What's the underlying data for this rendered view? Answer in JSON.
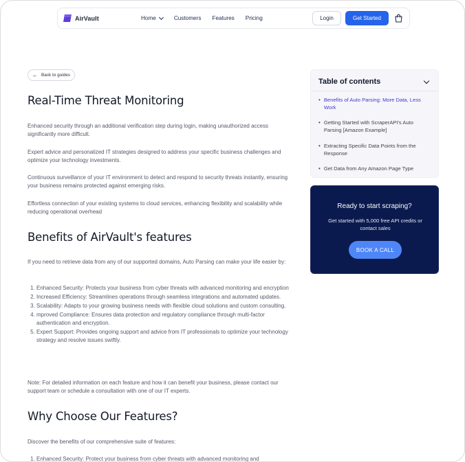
{
  "nav": {
    "brand": "AirVault",
    "menu": [
      "Home",
      "Customers",
      "Features",
      "Pricing"
    ],
    "login": "Login",
    "get_started": "Get Started"
  },
  "main": {
    "back": "Back to guides",
    "title": "Real-Time Threat Monitoring",
    "paragraphs": [
      "Enhanced security through an additional verification step during login, making unauthorized access significantly more difficult.",
      "Expert advice and personalized IT strategies designed to address your specific business challenges and optimize your technology investments.",
      "Continuous surveillance of your IT environment to detect and respond to security threats instantly, ensuring your business remains protected against emerging risks.",
      "Effortless connection of your existing systems to cloud services, enhancing flexibility and scalability while reducing operational overhead"
    ],
    "section2_title": "Benefits of AirVault's features",
    "section2_intro": "If you need to retrieve data from any of our supported domains, Auto Parsing can make your life easier by:",
    "section2_list": [
      "Enhanced Security: Protects your business from cyber threats with advanced monitoring and encryption",
      "Increased Efficiency: Streamlines operations through seamless integrations and automated updates.",
      "Scalability: Adapts to your growing business needs with flexible cloud solutions and custom consulting.",
      "mproved Compliance: Ensures data protection and regulatory compliance through multi-factor authentication and encryption.",
      "Expert Support: Provides ongoing support and advice from IT professionals to optimize your technology strategy and resolve issues swiftly."
    ],
    "section2_note": "Note: For detailed information on each feature and how it can benefit your business, please contact our support team or schedule a consultation with one of our IT experts.",
    "section3_title": "Why Choose Our Features?",
    "section3_intro": "Discover the benefits of our comprehensive suite of features:",
    "section3_list": [
      "Enhanced Security: Protect your business from cyber threats with advanced monitoring and"
    ]
  },
  "toc": {
    "title": "Table of contents",
    "items": [
      "Benefits of Auto Parsing: More Data, Less Work",
      "Getting Started with ScraperAPI's Auto Parsing [Amazon Example]",
      "Extracting Specific Data Points from the Response",
      "Get Data from Any Amazon Page Type"
    ]
  },
  "cta": {
    "title": "Ready to start scraping?",
    "subtitle": "Get started with 5,000 free API credits or contact sales",
    "button": "BOOK A CALL"
  },
  "colors": {
    "accent": "#2563eb",
    "cta_bg": "#0b1a4e",
    "cta_button": "#4f86f7",
    "toc_active": "#4338ca"
  },
  "icons": {
    "logo": "airvault-logo-icon",
    "menu_chevron": "chevron-down-icon",
    "cart": "shopping-bag-icon",
    "back": "arrow-left-icon",
    "toc_chevron": "chevron-down-icon"
  }
}
